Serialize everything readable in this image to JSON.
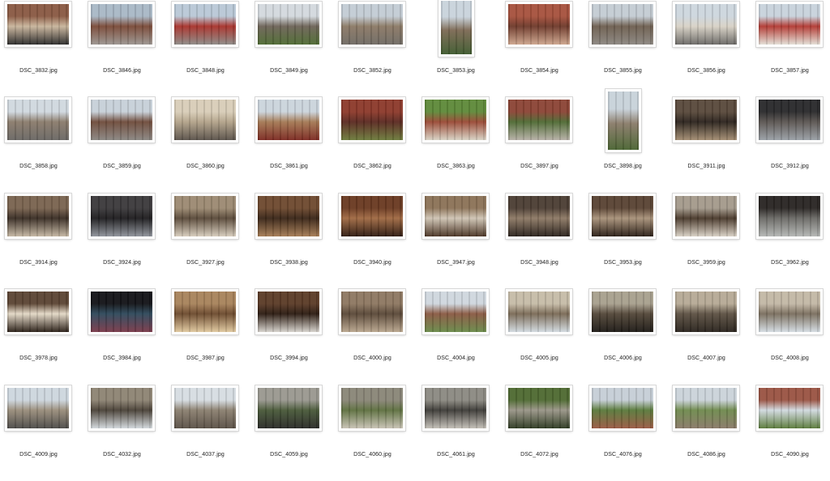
{
  "files": [
    {
      "name": "DSC_3832.jpg",
      "orientation": "landscape",
      "colors": [
        "#8a5a44",
        "#c9b59c",
        "#2b2b2b"
      ]
    },
    {
      "name": "DSC_3846.jpg",
      "orientation": "landscape",
      "colors": [
        "#a9b8c6",
        "#7a4a38",
        "#9b9590"
      ]
    },
    {
      "name": "DSC_3848.jpg",
      "orientation": "landscape",
      "colors": [
        "#b9c8d6",
        "#a8332c",
        "#8d8a86"
      ]
    },
    {
      "name": "DSC_3849.jpg",
      "orientation": "landscape",
      "colors": [
        "#d3d9de",
        "#6e6458",
        "#4f6b33"
      ]
    },
    {
      "name": "DSC_3852.jpg",
      "orientation": "landscape",
      "colors": [
        "#c3ccd4",
        "#8c7a66",
        "#6f6a64"
      ]
    },
    {
      "name": "DSC_3853.jpg",
      "orientation": "portrait",
      "colors": [
        "#c9d3dc",
        "#7d6a55",
        "#3f5b2f"
      ]
    },
    {
      "name": "DSC_3854.jpg",
      "orientation": "landscape",
      "colors": [
        "#a7523e",
        "#6e3a2b",
        "#cda58d"
      ]
    },
    {
      "name": "DSC_3855.jpg",
      "orientation": "landscape",
      "colors": [
        "#c4ccd3",
        "#6e5f50",
        "#8b8680"
      ]
    },
    {
      "name": "DSC_3856.jpg",
      "orientation": "landscape",
      "colors": [
        "#cdd6de",
        "#d8d2c6",
        "#6a6865"
      ]
    },
    {
      "name": "DSC_3857.jpg",
      "orientation": "landscape",
      "colors": [
        "#c8d2dc",
        "#b23a33",
        "#e3ded5"
      ]
    },
    {
      "name": "DSC_3858.jpg",
      "orientation": "landscape",
      "colors": [
        "#d0d8df",
        "#8b7c6c",
        "#6a6764"
      ]
    },
    {
      "name": "DSC_3859.jpg",
      "orientation": "landscape",
      "colors": [
        "#c7d0d8",
        "#6f4c3c",
        "#8a8682"
      ]
    },
    {
      "name": "DSC_3860.jpg",
      "orientation": "landscape",
      "colors": [
        "#d8cdb8",
        "#b3a38a",
        "#5a524a"
      ]
    },
    {
      "name": "DSC_3861.jpg",
      "orientation": "landscape",
      "colors": [
        "#cbd4dc",
        "#a57a55",
        "#7c2a22"
      ]
    },
    {
      "name": "DSC_3862.jpg",
      "orientation": "landscape",
      "colors": [
        "#8d3a2c",
        "#5b2a22",
        "#6d7b3c"
      ]
    },
    {
      "name": "DSC_3863.jpg",
      "orientation": "landscape",
      "colors": [
        "#5f8a3a",
        "#9a4a36",
        "#d8d2c4"
      ]
    },
    {
      "name": "DSC_3897.jpg",
      "orientation": "landscape",
      "colors": [
        "#8c4536",
        "#4f6a34",
        "#b6b0a6"
      ]
    },
    {
      "name": "DSC_3898.jpg",
      "orientation": "portrait",
      "colors": [
        "#c8d2da",
        "#8a7c6a",
        "#4a6432"
      ]
    },
    {
      "name": "DSC_3911.jpg",
      "orientation": "landscape",
      "colors": [
        "#5a4a3c",
        "#2c241e",
        "#a38d72"
      ]
    },
    {
      "name": "DSC_3912.jpg",
      "orientation": "landscape",
      "colors": [
        "#2a2a2c",
        "#5c5652",
        "#9aa0a6"
      ]
    },
    {
      "name": "DSC_3914.jpg",
      "orientation": "landscape",
      "colors": [
        "#7a6450",
        "#3a2e25",
        "#c4b6a2"
      ]
    },
    {
      "name": "DSC_3924.jpg",
      "orientation": "landscape",
      "colors": [
        "#3c3a3c",
        "#1e1d1f",
        "#8e929a"
      ]
    },
    {
      "name": "DSC_3927.jpg",
      "orientation": "landscape",
      "colors": [
        "#9c8a72",
        "#5a4a3a",
        "#d6ccbc"
      ]
    },
    {
      "name": "DSC_3938.jpg",
      "orientation": "landscape",
      "colors": [
        "#6e4a30",
        "#3a2618",
        "#a57c55"
      ]
    },
    {
      "name": "DSC_3940.jpg",
      "orientation": "landscape",
      "colors": [
        "#6a3a22",
        "#a06a44",
        "#2e1a10"
      ]
    },
    {
      "name": "DSC_3947.jpg",
      "orientation": "landscape",
      "colors": [
        "#8c7358",
        "#cfc4b4",
        "#4a3424"
      ]
    },
    {
      "name": "DSC_3948.jpg",
      "orientation": "landscape",
      "colors": [
        "#4c3e34",
        "#8e7a66",
        "#2a221c"
      ]
    },
    {
      "name": "DSC_3953.jpg",
      "orientation": "landscape",
      "colors": [
        "#5a4434",
        "#a8927a",
        "#2a1e16"
      ]
    },
    {
      "name": "DSC_3959.jpg",
      "orientation": "landscape",
      "colors": [
        "#a49a8c",
        "#4a3a2c",
        "#d8d0c4"
      ]
    },
    {
      "name": "DSC_3962.jpg",
      "orientation": "landscape",
      "colors": [
        "#2a2624",
        "#6b6a66",
        "#b4b6b4"
      ]
    },
    {
      "name": "DSC_3978.jpg",
      "orientation": "landscape",
      "colors": [
        "#5c4534",
        "#e3d8c6",
        "#2a1f17"
      ]
    },
    {
      "name": "DSC_3984.jpg",
      "orientation": "landscape",
      "colors": [
        "#141418",
        "#2f4a5c",
        "#7a3a4a"
      ]
    },
    {
      "name": "DSC_3987.jpg",
      "orientation": "landscape",
      "colors": [
        "#a8835c",
        "#6c4a2e",
        "#e0c89e"
      ]
    },
    {
      "name": "DSC_3994.jpg",
      "orientation": "landscape",
      "colors": [
        "#5c3c28",
        "#2c1c12",
        "#d6d2cc"
      ]
    },
    {
      "name": "DSC_4000.jpg",
      "orientation": "landscape",
      "colors": [
        "#8e7862",
        "#5a4838",
        "#b9a68e"
      ]
    },
    {
      "name": "DSC_4004.jpg",
      "orientation": "landscape",
      "colors": [
        "#cfd7de",
        "#8a5a44",
        "#6a8a4a"
      ]
    },
    {
      "name": "DSC_4005.jpg",
      "orientation": "landscape",
      "colors": [
        "#c6bca8",
        "#7a6a56",
        "#d2dae0"
      ]
    },
    {
      "name": "DSC_4006.jpg",
      "orientation": "landscape",
      "colors": [
        "#a8a08e",
        "#54483a",
        "#1e1a16"
      ]
    },
    {
      "name": "DSC_4007.jpg",
      "orientation": "landscape",
      "colors": [
        "#b6aa96",
        "#5e5244",
        "#2a241e"
      ]
    },
    {
      "name": "DSC_4008.jpg",
      "orientation": "landscape",
      "colors": [
        "#c3b8a6",
        "#7a6e5e",
        "#d4dce2"
      ]
    },
    {
      "name": "DSC_4009.jpg",
      "orientation": "landscape",
      "colors": [
        "#cdd6de",
        "#9a8e7c",
        "#4c4a48"
      ]
    },
    {
      "name": "DSC_4032.jpg",
      "orientation": "landscape",
      "colors": [
        "#8e8474",
        "#4a4238",
        "#d2d8dc"
      ]
    },
    {
      "name": "DSC_4037.jpg",
      "orientation": "landscape",
      "colors": [
        "#d6dde2",
        "#8b8070",
        "#5a5046"
      ]
    },
    {
      "name": "DSC_4059.jpg",
      "orientation": "landscape",
      "colors": [
        "#9a9890",
        "#4a5a3a",
        "#2a2a28"
      ]
    },
    {
      "name": "DSC_4060.jpg",
      "orientation": "landscape",
      "colors": [
        "#8a8678",
        "#5e7040",
        "#c8c2b4"
      ]
    },
    {
      "name": "DSC_4061.jpg",
      "orientation": "landscape",
      "colors": [
        "#8c8a82",
        "#3e3c38",
        "#c2beb6"
      ]
    },
    {
      "name": "DSC_4072.jpg",
      "orientation": "landscape",
      "colors": [
        "#4f6a32",
        "#9a9688",
        "#2e3a22"
      ]
    },
    {
      "name": "DSC_4076.jpg",
      "orientation": "landscape",
      "colors": [
        "#c6ced6",
        "#5a7a3c",
        "#9a5a44"
      ]
    },
    {
      "name": "DSC_4086.jpg",
      "orientation": "landscape",
      "colors": [
        "#cbd3da",
        "#6f8a4e",
        "#8a7a68"
      ]
    },
    {
      "name": "DSC_4090.jpg",
      "orientation": "landscape",
      "colors": [
        "#9a5444",
        "#d2dae0",
        "#5a7a3a"
      ]
    }
  ]
}
